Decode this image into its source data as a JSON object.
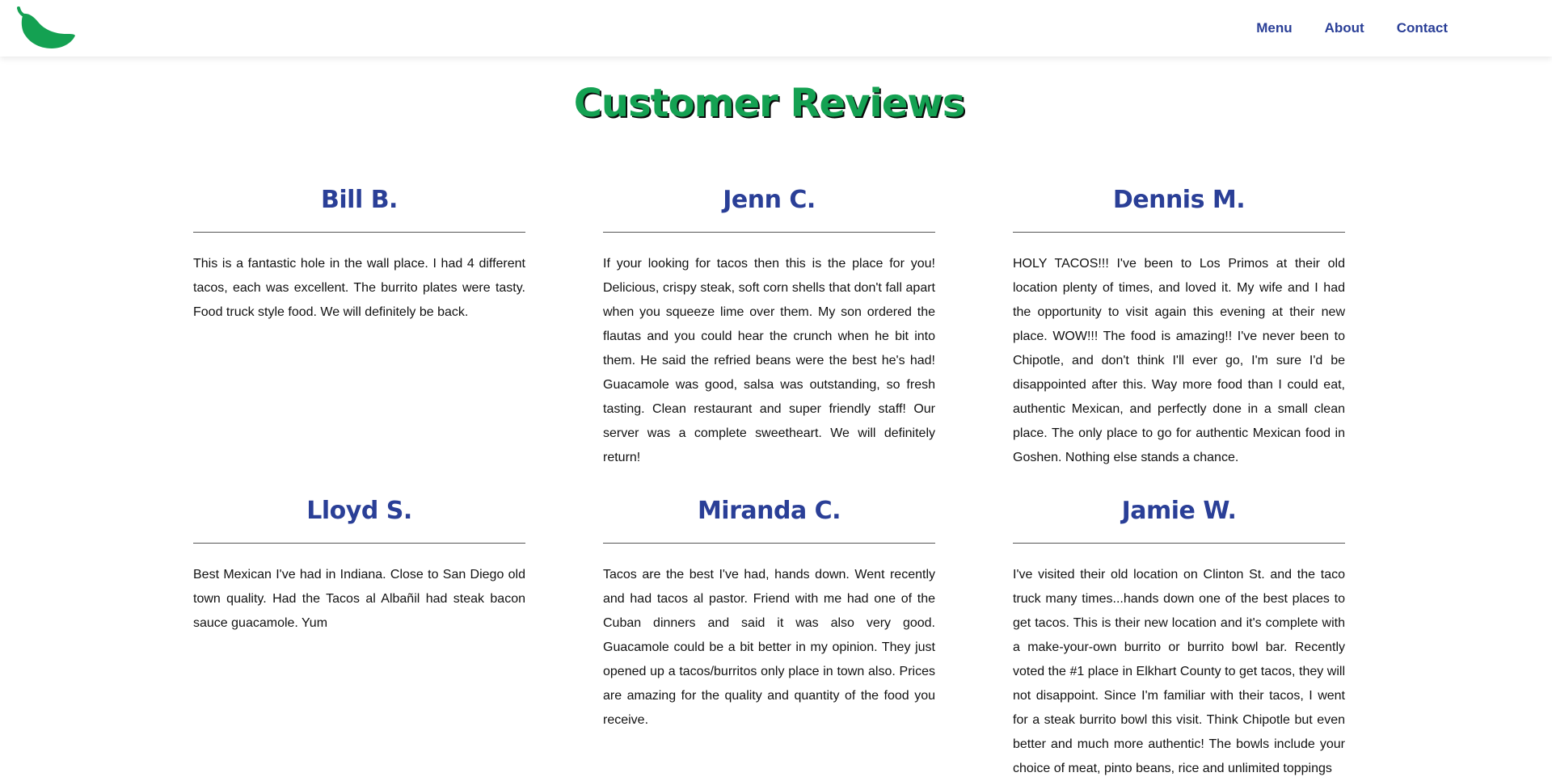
{
  "header": {
    "logo_icon": "chili-pepper-icon",
    "nav": [
      "Menu",
      "About",
      "Contact"
    ]
  },
  "page_title": "Customer Reviews",
  "colors": {
    "brand_green": "#14a152",
    "accent_blue": "#2a3f97",
    "text": "#111111"
  },
  "reviews": [
    {
      "name": "Bill B.",
      "text": "This is a fantastic hole in the wall place. I had 4 different tacos, each was excellent. The burrito plates were tasty. Food truck style food. We will definitely be back."
    },
    {
      "name": "Jenn C.",
      "text": "If your looking for tacos then this is the place for you! Delicious, crispy steak, soft corn shells that don't fall apart when you squeeze lime over them. My son ordered the flautas and you could hear the crunch when he bit into them. He said the refried beans were the best he's had! Guacamole was good, salsa was outstanding, so fresh tasting. Clean restaurant and super friendly staff! Our server was a complete sweetheart. We will definitely return!"
    },
    {
      "name": "Dennis M.",
      "text": "HOLY TACOS!!! I've been to Los Primos at their old location plenty of times, and loved it. My wife and I had the opportunity to visit again this evening at their new place. WOW!!! The food is amazing!! I've never been to Chipotle, and don't think I'll ever go, I'm sure I'd  be disappointed after this. Way more food than I could eat, authentic Mexican, and perfectly done in a small clean place. The only place to go for authentic Mexican food in Goshen. Nothing else stands a chance."
    },
    {
      "name": "Lloyd S.",
      "text": "Best Mexican I've had in Indiana. Close to San Diego old town quality. Had the Tacos  al Albañil had steak bacon sauce guacamole. Yum"
    },
    {
      "name": "Miranda C.",
      "text": "Tacos are the best I've had, hands down.  Went recently and had tacos al pastor.  Friend with me had one of the Cuban dinners and said it was also very good.  Guacamole could be a bit better in my opinion.  They just opened up a tacos/burritos only place in town also.  Prices are amazing for the quality and quantity of the food you receive."
    },
    {
      "name": "Jamie W.",
      "text": "I've visited their old location on Clinton St. and the taco truck many times...hands down one of the best places to get tacos. This is their new location and it's complete with a make-your-own burrito or burrito bowl bar. Recently voted the #1 place in Elkhart County to get tacos, they will not disappoint. Since I'm familiar with their tacos, I went for a steak burrito bowl this visit. Think Chipotle but even better and much more authentic! The bowls include your choice of meat, pinto beans, rice and unlimited toppings"
    }
  ]
}
